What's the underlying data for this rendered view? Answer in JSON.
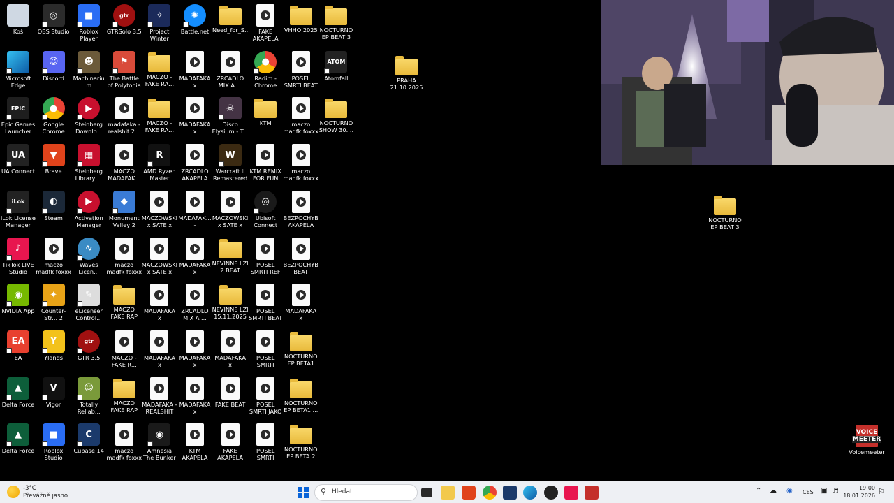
{
  "desktop": {
    "col0": [
      "Koš",
      "Microsoft Edge",
      "Epic Games Launcher",
      "UA Connect",
      "iLok License Manager",
      "TikTok LIVE Studio",
      "NVIDIA App",
      "EA",
      "Delta Force",
      "Delta Force"
    ],
    "col1": [
      "OBS Studio",
      "Discord",
      "Google Chrome",
      "Brave",
      "Steam",
      "maczo madfk foxxx - kill b...",
      "Counter-Str... 2",
      "Ylands",
      "Vigor",
      "Roblox Studio"
    ],
    "col2": [
      "Roblox Player",
      "Machinarium",
      "Steinberg Downlo...",
      "Steinberg Library ...",
      "Activation Manager",
      "Waves Licen...",
      "eLicenser Control...",
      "GTR 3.5",
      "Totally Reliab...",
      "Cubase 14"
    ],
    "col3": [
      "GTRSolo 3.5",
      "The Battle of Polytopia",
      "madafaka - realshit 2...",
      "MACZO MADAFAK...",
      "Monument Valley 2",
      "maczo madfk foxxx - kill b...",
      "MACZO FAKE RAP 3.10.20...",
      "MACZO - FAKE R...",
      "MACZO FAKE RAP 3.10.20...",
      "maczo madfk foxxx - kill b..."
    ],
    "col4": [
      "Project Winter",
      "MACZO - FAKE RA...",
      "MACZO - FAKE RA...",
      "AMD Ryzen Master",
      "MACZOWSKI x SATE x M...",
      "MACZOWSKI x SATE x M...",
      "MADAFAKA x MACZOWS...",
      "MADAFAKA x MACZOWS...",
      "MADAFAKA - REALSHIT 1...",
      "Amnesia The Bunker"
    ],
    "col5": [
      "Battle.net",
      "MADAFAKA x MACZOWS...",
      "MADAFAKA x MACZOWS...",
      "ZRCADLO AKAPELA",
      "MADAFAK... - ZRCADLO...",
      "MADAFAKA x MACZOWS...",
      "ZRCADLO MIX A ...",
      "MADAFAKA x MACZOWS...",
      "MADAFAKA x MACZOWS...",
      "KTM AKAPELA"
    ],
    "col6": [
      "Need_for_S...",
      "ZRCADLO MIX A ...",
      "Disco Elysium - T...",
      "Warcraft II Remastered",
      "MACZOWSKI x SATE x M...",
      "NEVINNE LZI 2 BEAT",
      "NEVINNE LZI 15.11.2025",
      "MADAFAKA x MACZOWS...",
      "FAKE BEAT",
      "FAKE AKAPELA"
    ],
    "col7": [
      "FAKE AKAPELA C...",
      "Radim - Chrome",
      "KTM",
      "KTM REMIX FOR FUN",
      "Ubisoft Connect",
      "POSEL SMRTI REF",
      "POSEL SMRTI BEAT",
      "POSEL SMRTI AKAPELA 11",
      "POSEL SMRTI JAKO VZOR",
      "POSEL SMRTI AKAPELA 2..."
    ],
    "col8": [
      "VHHO 2025",
      "POSEL SMRTI BEAT 23.11....",
      "maczo madfk foxxx - kill b...",
      "maczo madfk foxxx - kill b...",
      "BEZPOCHYB AKAPELA",
      "BEZPOCHYB BEAT",
      "MADAFAKA x MACZOWS...",
      "NOCTURNO EP BETA1",
      "NOCTURNO EP BETA1 ...",
      "NOCTURNO EP BETA 2"
    ],
    "col9": [
      "NOCTURNO EP BEAT 3",
      "Atomfall",
      "NOCTURNO SHOW 30...."
    ],
    "extra": {
      "praha": "PRAHA 21.10.2025",
      "nocturno": "NOCTURNO EP BEAT 3",
      "voicemeeter": "Voicemeeter",
      "vm_logo_1": "VOICE",
      "vm_logo_2": "MEETER"
    }
  },
  "taskbar": {
    "weather_temp": "-3°C",
    "weather_desc": "Převážně jasno",
    "search_placeholder": "Hledat",
    "lang": "CES",
    "time": "19:00",
    "date": "18.01.2026"
  },
  "colors": {
    "accent": "#0a64d8",
    "folder": "#f2c94c"
  }
}
